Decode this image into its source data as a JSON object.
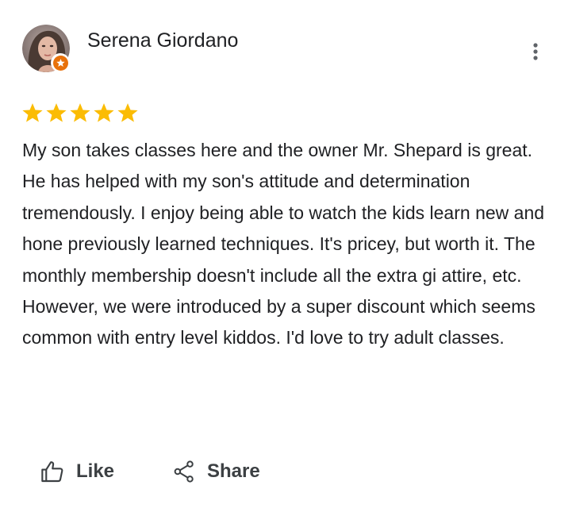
{
  "review": {
    "reviewer_name": "Serena Giordano",
    "local_guide_badge": "local-guide-badge-icon",
    "rating": 5,
    "rating_max": 5,
    "star_color": "#fbbc04",
    "text": "My son takes classes here and the owner Mr. Shepard is great. He has helped with my son's attitude and determination tremendously. I enjoy being able to watch the kids learn new and hone previously learned techniques. It's pricey, but worth it. The monthly membership doesn't include all the extra gi attire, etc. However, we were introduced by a super discount which seems common with entry level kiddos. I'd love to try adult classes."
  },
  "actions": {
    "like_label": "Like",
    "share_label": "Share"
  },
  "icons": {
    "more": "more-vert-icon",
    "like": "thumb-up-icon",
    "share": "share-icon"
  },
  "colors": {
    "text_primary": "#202124",
    "text_secondary": "#3c4043",
    "badge": "#e8710a",
    "more_dots": "#5f6368"
  }
}
